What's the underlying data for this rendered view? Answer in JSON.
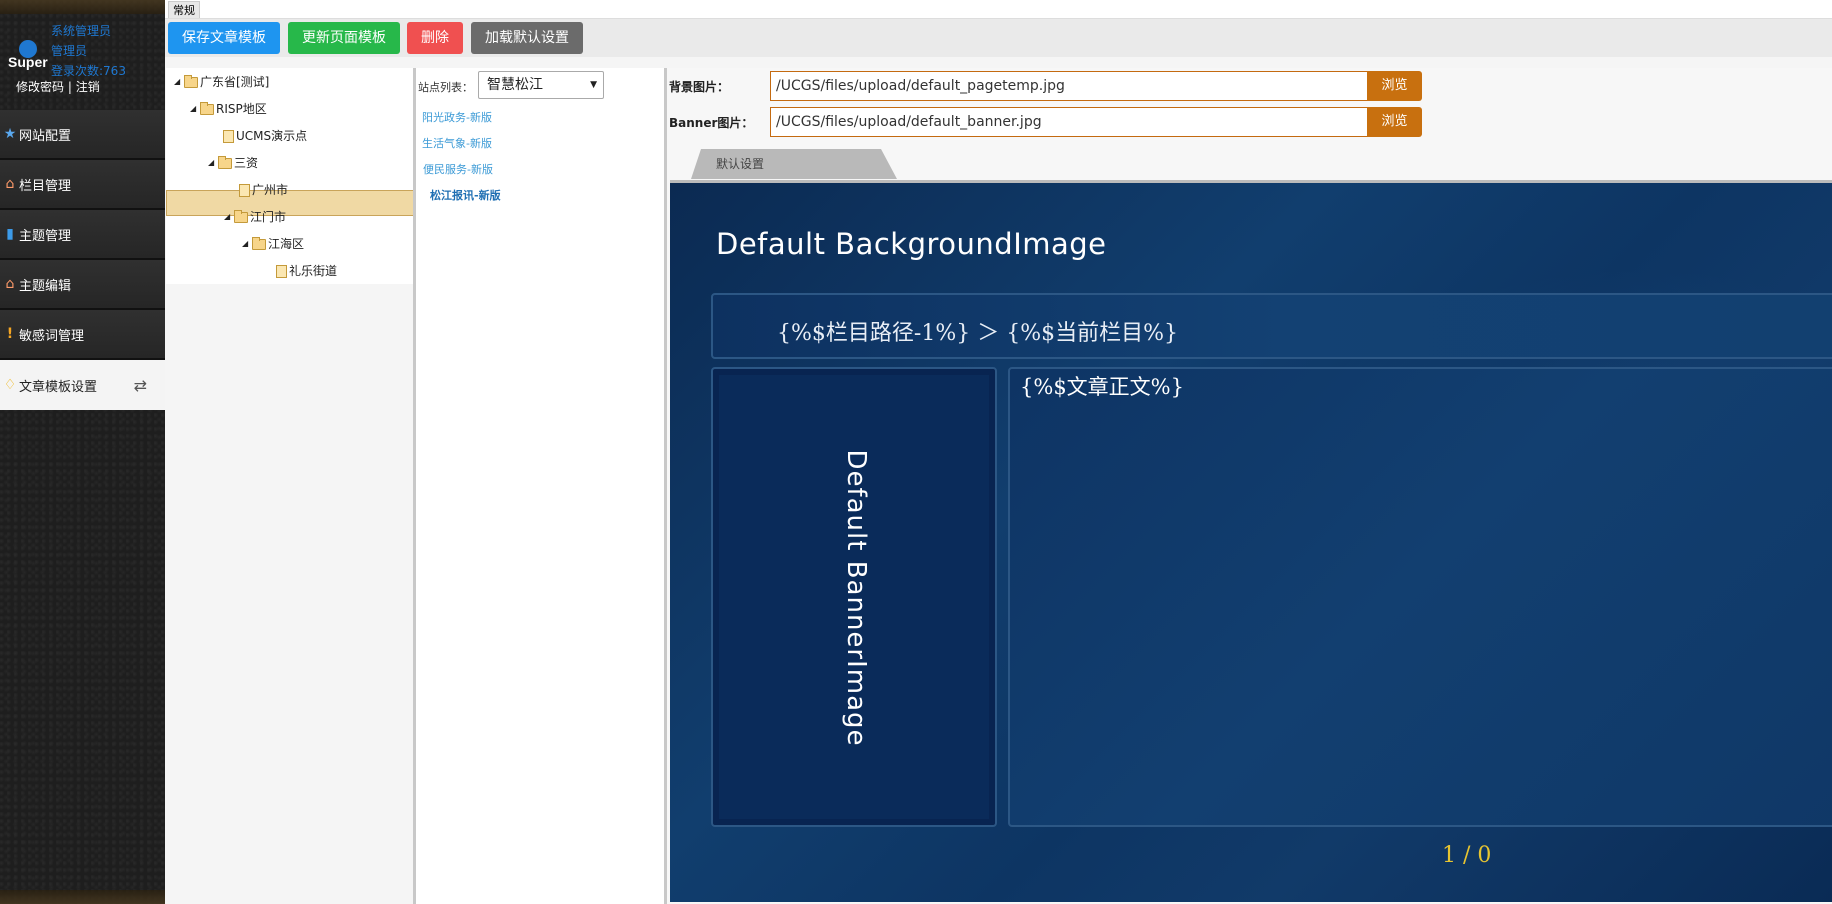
{
  "tabbar": {
    "tab_label": "常规"
  },
  "user": {
    "logo_text": "Super",
    "role": "系统管理员",
    "name": "管理员",
    "login_count": "登录次数:763",
    "change_password": "修改密码",
    "separator": "|",
    "logout": "注销"
  },
  "nav": {
    "items": [
      {
        "label": "网站配置",
        "icon": "star-icon"
      },
      {
        "label": "栏目管理",
        "icon": "house-icon"
      },
      {
        "label": "主题管理",
        "icon": "book-icon"
      },
      {
        "label": "主题编辑",
        "icon": "house-icon"
      },
      {
        "label": "敏感词管理",
        "icon": "alert-icon"
      },
      {
        "label": "文章模板设置",
        "icon": "bulb-icon",
        "active": true
      }
    ]
  },
  "toolbar": {
    "save_article_template": "保存文章模板",
    "update_page_template": "更新页面模板",
    "delete": "删除",
    "load_default": "加载默认设置"
  },
  "tree": {
    "nodes": [
      {
        "label": "广东省[测试]",
        "type": "folder",
        "expanded": true
      },
      {
        "label": "RISP地区",
        "type": "folder",
        "expanded": true
      },
      {
        "label": "UCMS演示点",
        "type": "file",
        "selected": true
      },
      {
        "label": "三资",
        "type": "folder",
        "expanded": true
      },
      {
        "label": "广州市",
        "type": "file"
      },
      {
        "label": "江门市",
        "type": "folder",
        "expanded": true
      },
      {
        "label": "江海区",
        "type": "folder",
        "expanded": true
      },
      {
        "label": "礼乐街道",
        "type": "file"
      }
    ]
  },
  "sites": {
    "label": "站点列表：",
    "selected": "智慧松江",
    "links": [
      "阳光政务-新版",
      "生活气象-新版",
      "便民服务-新版",
      "松江报讯-新版"
    ],
    "current_index": 3
  },
  "settings": {
    "bg_label": "背景图片：",
    "bg_value": "/UCGS/files/upload/default_pagetemp.jpg",
    "banner_label": "Banner图片：",
    "banner_value": "/UCGS/files/upload/default_banner.jpg",
    "browse": "浏览",
    "template_tab": "默认设置"
  },
  "preview": {
    "title": "Default BackgroundImage",
    "breadcrumb": "{%$栏目路径-1%} ＞ {%$当前栏目%}",
    "banner_text": "Default BannerImage",
    "body_text": "{%$文章正文%}",
    "pager": "1 / 0"
  },
  "colors": {
    "sidebar_bg": "#1e1e1e",
    "user_blue": "#1f78d1",
    "btn_blue": "#1e95f0",
    "btn_green": "#27b84a",
    "btn_red": "#f05050",
    "btn_gray": "#6b6b6b",
    "browse_orange": "#c8700f",
    "preview_bg": "#0b2a52",
    "pager_yellow": "#e6c431"
  }
}
